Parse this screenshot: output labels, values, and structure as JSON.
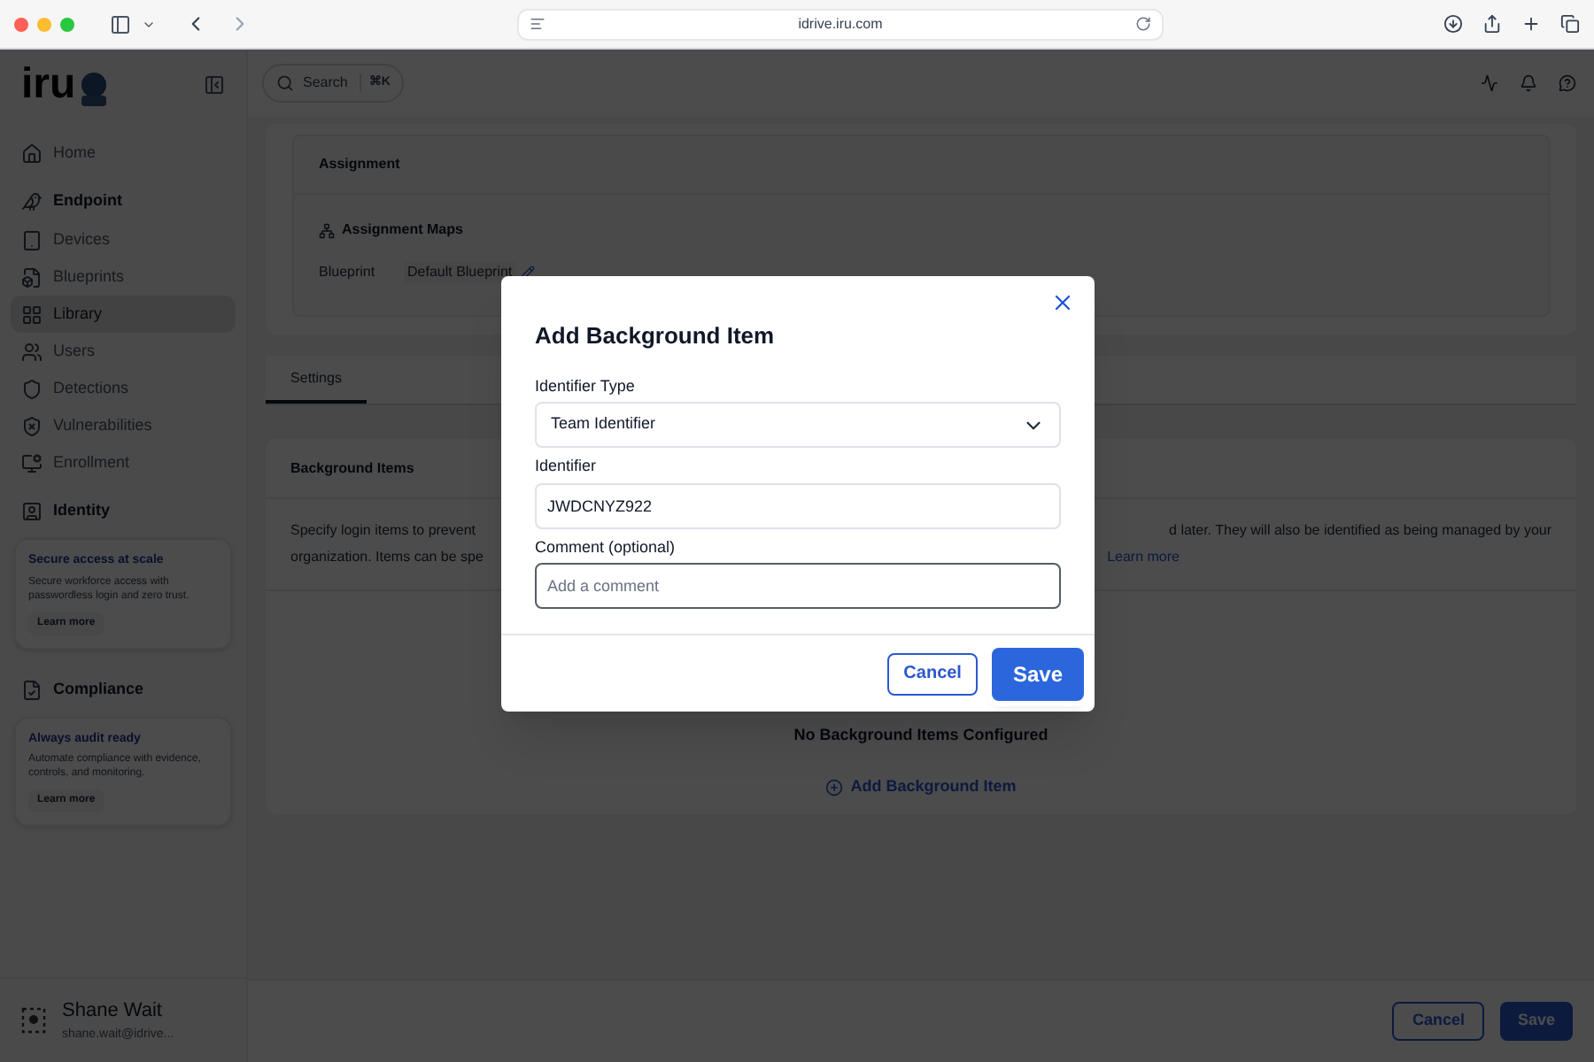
{
  "browser": {
    "url": "idrive.iru.com"
  },
  "sidebar": {
    "logo": "iru",
    "items": [
      {
        "kind": "item",
        "label": "Home",
        "selected": false
      },
      {
        "kind": "section",
        "label": "Endpoint"
      },
      {
        "kind": "item",
        "label": "Devices",
        "selected": false
      },
      {
        "kind": "item",
        "label": "Blueprints",
        "selected": false
      },
      {
        "kind": "item",
        "label": "Library",
        "selected": true
      },
      {
        "kind": "item",
        "label": "Users",
        "selected": false
      },
      {
        "kind": "item",
        "label": "Detections",
        "selected": false
      },
      {
        "kind": "item",
        "label": "Vulnerabilities",
        "selected": false
      },
      {
        "kind": "item",
        "label": "Enrollment",
        "selected": false
      },
      {
        "kind": "section",
        "label": "Identity"
      },
      {
        "kind": "promo",
        "title": "Secure access at scale",
        "text": "Secure workforce access with passwordless login and zero trust.",
        "button": "Learn more"
      },
      {
        "kind": "section",
        "label": "Compliance"
      },
      {
        "kind": "promo",
        "title": "Always audit ready",
        "text": "Automate compliance with evidence, controls, and monitoring.",
        "button": "Learn more"
      }
    ],
    "user": {
      "name": "Shane Wait",
      "email": "shane.wait@idrive..."
    }
  },
  "header": {
    "search": "Search",
    "shortcut": "⌘K"
  },
  "assignment": {
    "title": "Assignment",
    "maps_title": "Assignment Maps",
    "blueprint_label": "Blueprint",
    "blueprint_value": "Default Blueprint"
  },
  "tabs": [
    {
      "label": "Settings",
      "selected": true
    }
  ],
  "background_items": {
    "title": "Background Items",
    "line1_left": "Specify login items to prevent",
    "line1_right": "d later. They will also be identified as being managed by your",
    "line2_left": "organization. Items can be spe",
    "link": "Learn more",
    "empty": "No Background Items Configured",
    "add": "Add Background Item"
  },
  "footer": {
    "cancel": "Cancel",
    "save": "Save"
  },
  "modal": {
    "title": "Add Background Item",
    "fields": [
      {
        "kind": "select",
        "label": "Identifier Type",
        "value": "Team Identifier",
        "focused": false
      },
      {
        "kind": "text",
        "label": "Identifier",
        "value": "JWDCNYZ922",
        "focused": false
      },
      {
        "kind": "text",
        "label": "Comment (optional)",
        "placeholder": "Add a comment",
        "focused": true
      }
    ],
    "cancel": "Cancel",
    "save": "Save"
  }
}
